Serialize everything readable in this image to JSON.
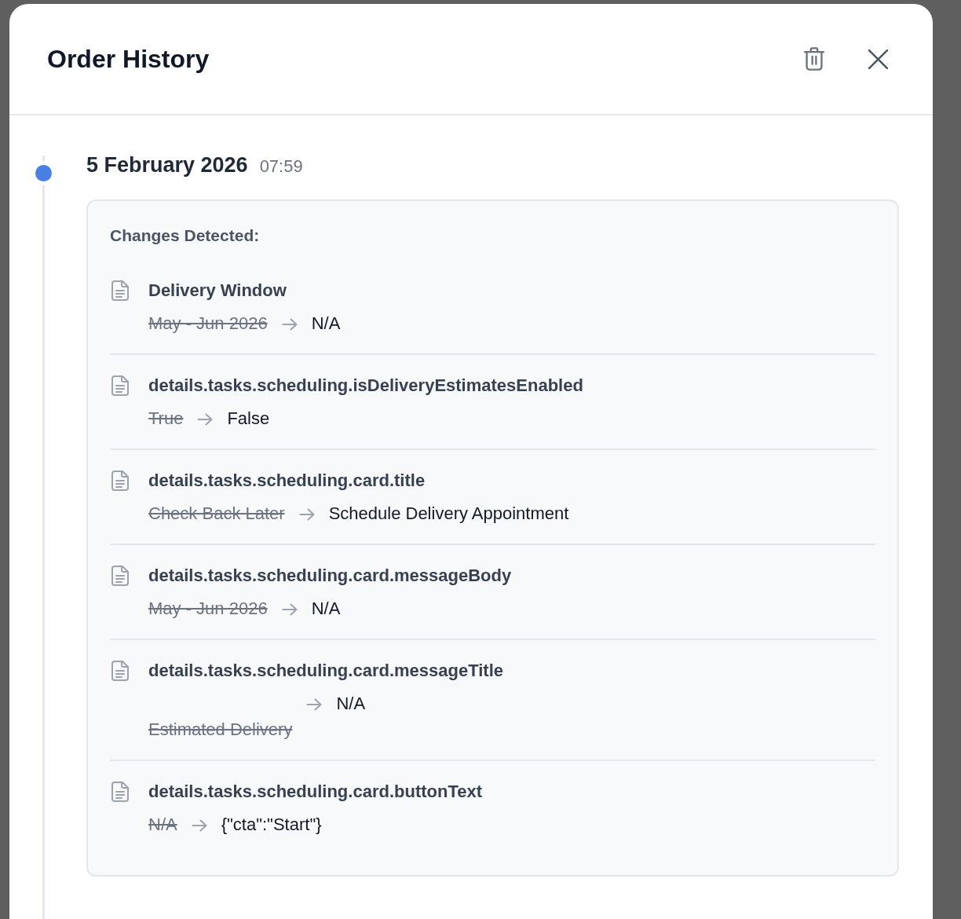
{
  "dialog": {
    "title": "Order History"
  },
  "timeline": [
    {
      "date": "5 February 2026",
      "time": "07:59",
      "heading": "Changes Detected:",
      "changes": [
        {
          "field": "Delivery Window",
          "old": "May - Jun 2026",
          "new": "N/A"
        },
        {
          "field": "details.tasks.scheduling.isDeliveryEstimatesEnabled",
          "old": "True",
          "new": "False"
        },
        {
          "field": "details.tasks.scheduling.card.title",
          "old": "Check Back Later",
          "new": "Schedule Delivery Appointment"
        },
        {
          "field": "details.tasks.scheduling.card.messageBody",
          "old": "May - Jun 2026",
          "new": "N/A"
        },
        {
          "field": "details.tasks.scheduling.card.messageTitle",
          "old": "\nEstimated Delivery",
          "new": "N/A"
        },
        {
          "field": "details.tasks.scheduling.card.buttonText",
          "old": "N/A",
          "new": "{\"cta\":\"Start\"}"
        }
      ]
    }
  ]
}
